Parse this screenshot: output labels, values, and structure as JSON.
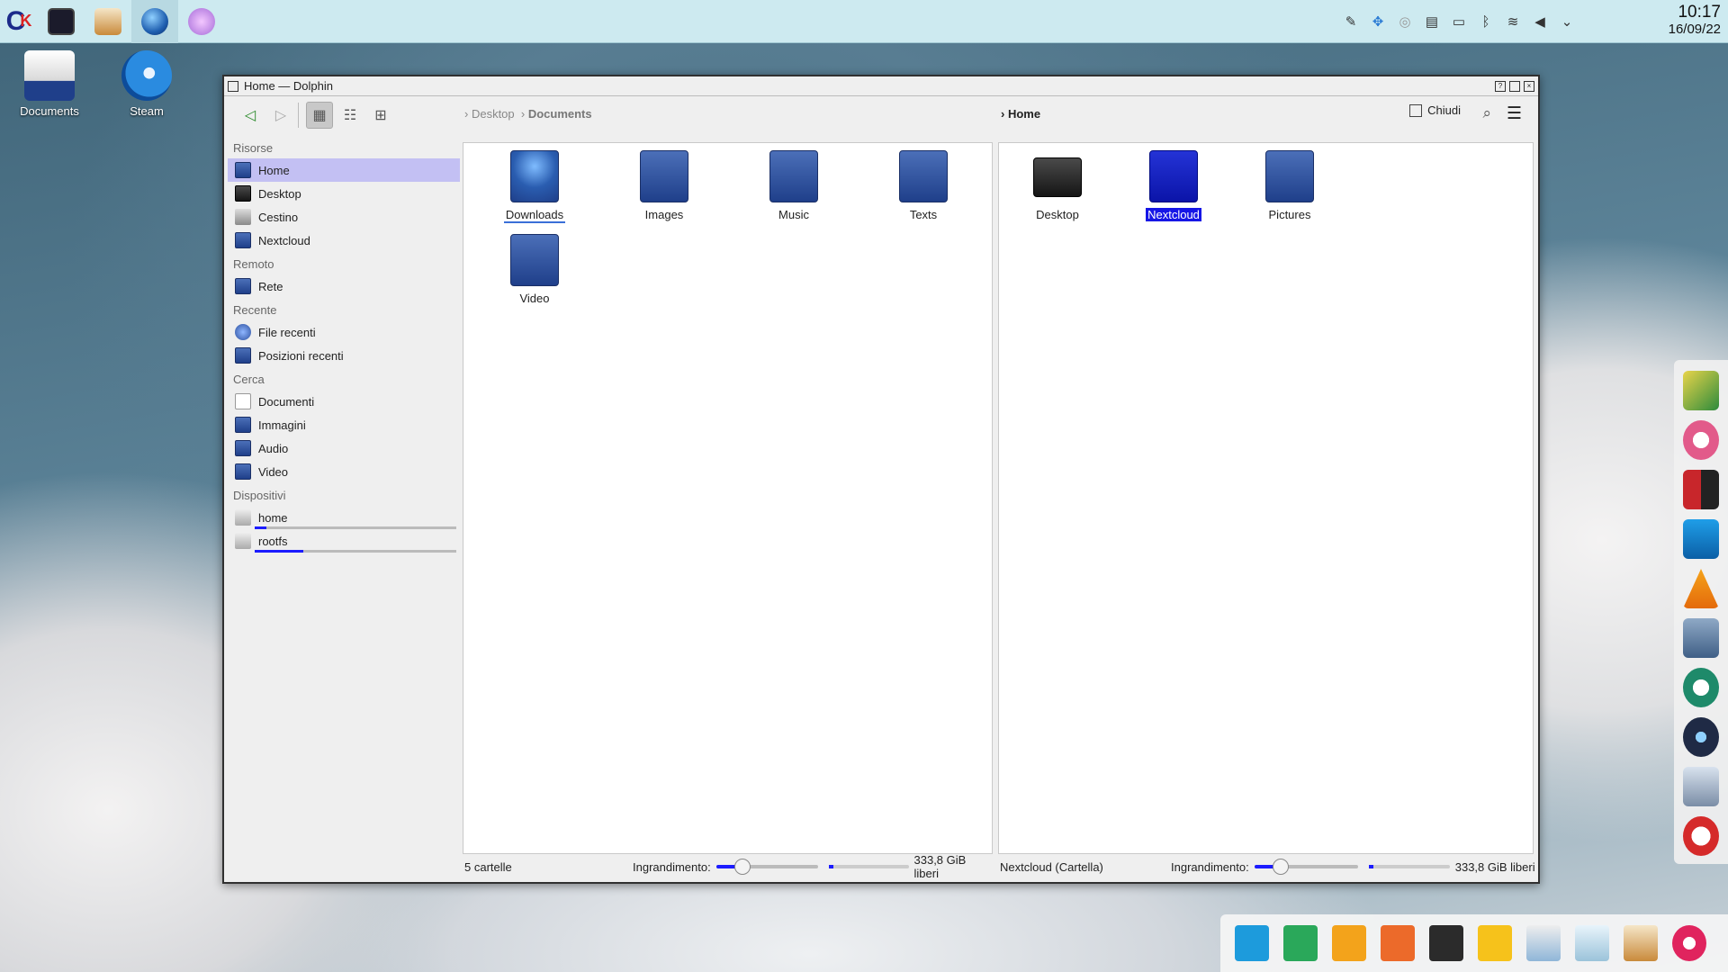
{
  "panel": {
    "clock_time": "10:17",
    "clock_date": "16/09/22",
    "tray_icons": [
      "pen-icon",
      "dropbox-icon",
      "tux-icon",
      "clipboard-icon",
      "battery-icon",
      "bluetooth-icon",
      "wifi-icon",
      "volume-icon",
      "chevron-down-icon"
    ],
    "tasks": [
      "window-manager-icon",
      "store-icon",
      "browser-icon",
      "session-icon"
    ]
  },
  "desktop": {
    "icons": [
      {
        "label": "Documents"
      },
      {
        "label": "Steam"
      }
    ]
  },
  "window": {
    "title": "Home — Dolphin",
    "toolbar": {
      "crumbs_left": [
        "Desktop",
        "Documents"
      ],
      "crumbs_right": "Home",
      "close_label": "Chiudi"
    },
    "sidebar": {
      "groups": [
        {
          "title": "Risorse",
          "items": [
            "Home",
            "Desktop",
            "Cestino",
            "Nextcloud"
          ]
        },
        {
          "title": "Remoto",
          "items": [
            "Rete"
          ]
        },
        {
          "title": "Recente",
          "items": [
            "File recenti",
            "Posizioni recenti"
          ]
        },
        {
          "title": "Cerca",
          "items": [
            "Documenti",
            "Immagini",
            "Audio",
            "Video"
          ]
        },
        {
          "title": "Dispositivi",
          "items": [
            "home",
            "rootfs"
          ]
        }
      ],
      "device_usage": {
        "home": 0.06,
        "rootfs": 0.24
      }
    },
    "left_pane": {
      "items": [
        "Downloads",
        "Images",
        "Music",
        "Texts",
        "Video"
      ],
      "status": "5 cartelle",
      "zoom_label": "Ingrandimento:",
      "zoom_level": 0.25,
      "free_space": "333,8 GiB liberi"
    },
    "right_pane": {
      "items": [
        "Desktop",
        "Nextcloud",
        "Pictures"
      ],
      "selected": "Nextcloud",
      "status": "Nextcloud (Cartella)",
      "zoom_label": "Ingrandimento:",
      "zoom_level": 0.25,
      "free_space": "333,8 GiB liberi"
    }
  },
  "colors": {
    "selection": "#1616e6",
    "sidebar_selection": "#c3c0f3",
    "panel_bg": "#cdeaf0",
    "accent": "#1c1cff"
  }
}
